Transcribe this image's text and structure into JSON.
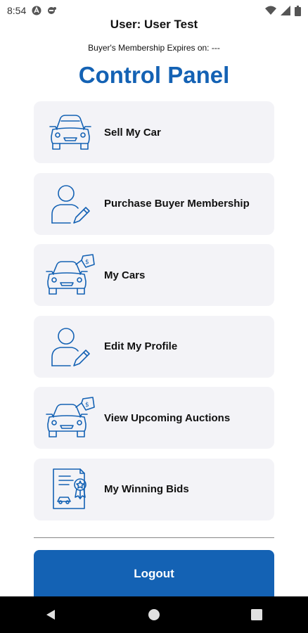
{
  "status_bar": {
    "time": "8:54",
    "icons": [
      "accessibility-icon",
      "dnd-icon",
      "wifi-icon",
      "signal-icon",
      "battery-icon"
    ]
  },
  "header": {
    "user_line": "User: User Test",
    "membership_line": "Buyer's Membership Expires on: ---",
    "title": "Control Panel"
  },
  "menu": [
    {
      "label": "Sell My Car",
      "icon": "car-icon"
    },
    {
      "label": "Purchase Buyer Membership",
      "icon": "user-edit-icon"
    },
    {
      "label": "My Cars",
      "icon": "car-price-tag-icon"
    },
    {
      "label": "Edit My Profile",
      "icon": "user-edit-icon"
    },
    {
      "label": "View Upcoming Auctions",
      "icon": "car-price-tag-icon"
    },
    {
      "label": "My Winning Bids",
      "icon": "certificate-icon"
    }
  ],
  "logout": {
    "label": "Logout"
  },
  "colors": {
    "accent": "#1462b4",
    "card_bg": "#f3f3f7"
  },
  "nav": [
    "back-icon",
    "home-icon",
    "recents-icon"
  ]
}
